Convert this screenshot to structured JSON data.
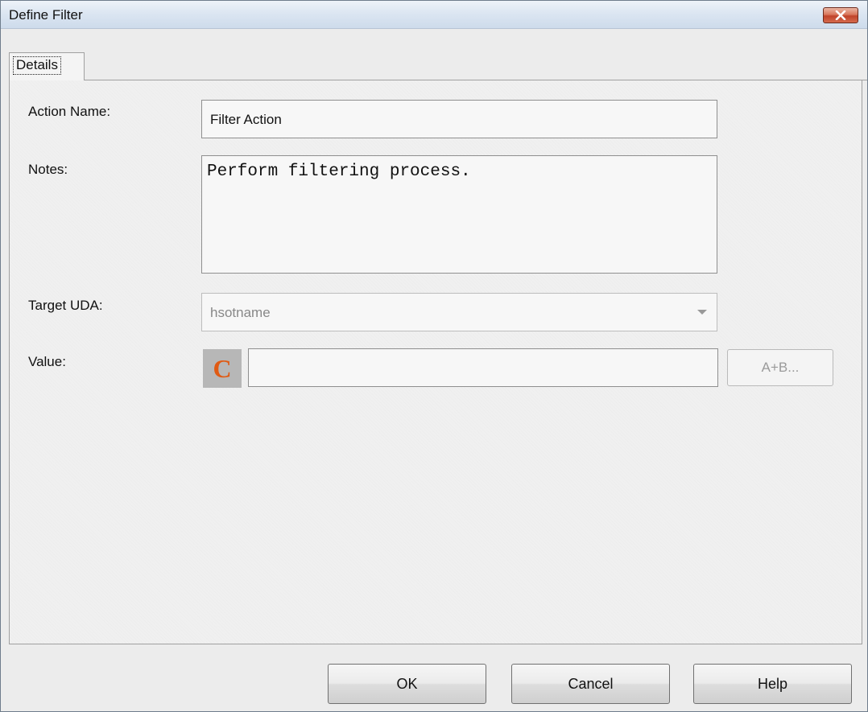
{
  "window": {
    "title": "Define Filter",
    "close_icon": "close-icon"
  },
  "tabs": [
    {
      "label": "Details",
      "selected": true
    }
  ],
  "form": {
    "action_name_label": "Action Name:",
    "action_name_value": "Filter Action",
    "notes_label": "Notes:",
    "notes_value": "Perform filtering process.",
    "target_uda_label": "Target UDA:",
    "target_uda_value": "hsotname",
    "value_label": "Value:",
    "value_type_icon_letter": "C",
    "value_value": "",
    "expression_button_label": "A+B..."
  },
  "buttons": {
    "ok": "OK",
    "cancel": "Cancel",
    "help": "Help"
  },
  "colors": {
    "title_bar": "#dce6f2",
    "close_button": "#c94a2e",
    "c_icon_letter": "#e05a13"
  }
}
